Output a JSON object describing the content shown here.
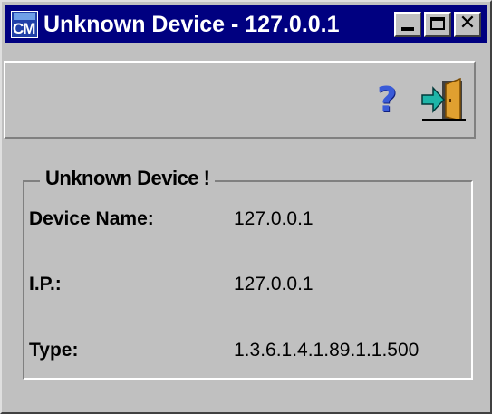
{
  "window": {
    "title": "Unknown Device - 127.0.0.1",
    "app_icon_text": "CM"
  },
  "titlebar_buttons": {
    "minimize": "minimize-icon",
    "maximize": "maximize-icon",
    "close_label": "✕"
  },
  "toolbar": {
    "help_label": "?",
    "help_icon": "help-icon",
    "exit_icon": "exit-door-icon"
  },
  "group": {
    "title": "Unknown Device !",
    "fields": [
      {
        "label": "Device Name:",
        "value": "127.0.0.1"
      },
      {
        "label": "I.P.:",
        "value": "127.0.0.1"
      },
      {
        "label": "Type:",
        "value": "1.3.6.1.4.1.89.1.1.500"
      }
    ]
  },
  "colors": {
    "titlebar": "#000080",
    "face": "#c0c0c0",
    "help_icon": "#3a5bd8",
    "exit_arrow": "#1fb5a8"
  }
}
